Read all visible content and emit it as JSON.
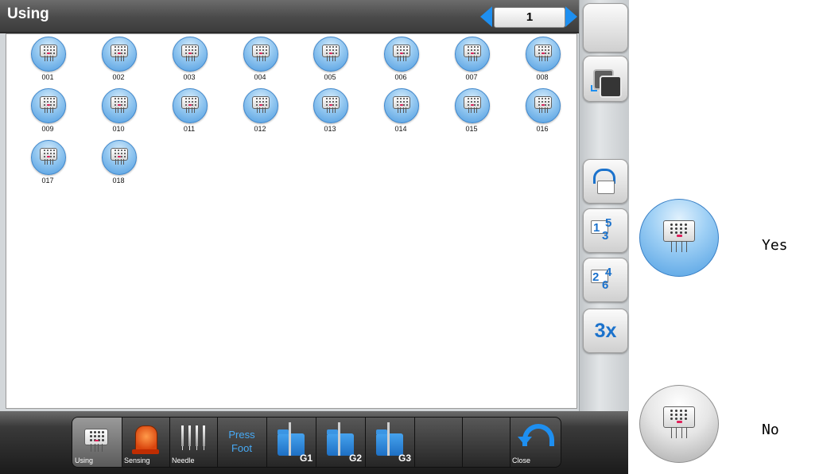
{
  "header": {
    "title": "Using",
    "page_number": "1"
  },
  "feet": [
    "001",
    "002",
    "003",
    "004",
    "005",
    "006",
    "007",
    "008",
    "009",
    "010",
    "011",
    "012",
    "013",
    "014",
    "015",
    "016",
    "017",
    "018"
  ],
  "sidebar": {
    "group_a_numbers": [
      "1",
      "5",
      "3"
    ],
    "group_b_numbers": [
      "2",
      "4",
      "6"
    ],
    "times_label": "3x"
  },
  "toolbar": {
    "using_label": "Using",
    "sensing_label": "Sensing",
    "needle_label": "Needle",
    "press_line1": "Press",
    "press_line2": "Foot",
    "g1_label": "G1",
    "g2_label": "G2",
    "g3_label": "G3",
    "close_label": "Close"
  },
  "legend": {
    "yes_label": "Yes",
    "no_label": "No"
  },
  "colors": {
    "accent": "#1e8ff0",
    "selected_foot": "#4e9be0",
    "unselected_foot": "#a7a7a7",
    "marker": "#e0205a"
  },
  "icons": [
    "presser-foot-icon",
    "arrow-left-icon",
    "arrow-right-icon",
    "copy-icon",
    "loop-icon",
    "folder-icon",
    "needle-icon",
    "lamp-icon",
    "close-arrow-icon"
  ]
}
